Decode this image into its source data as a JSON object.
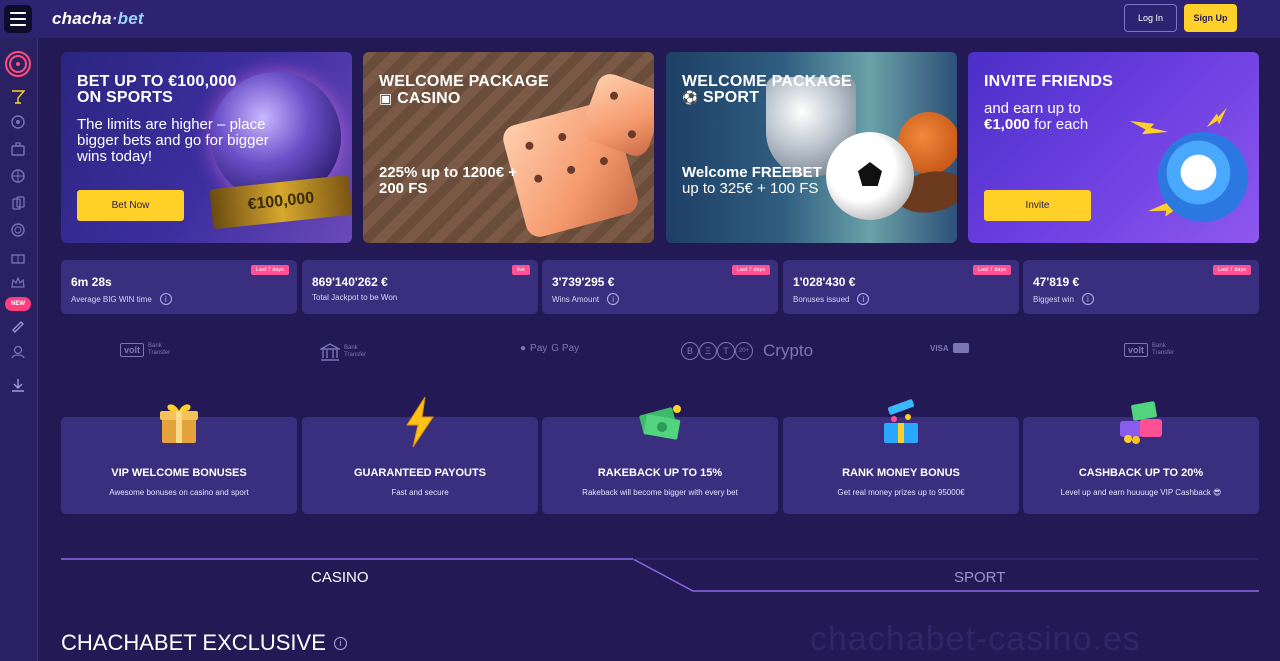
{
  "header": {
    "logo_main": "chacha",
    "logo_dot": "·",
    "logo_sub": "bet",
    "login_label": "Log In",
    "signup_label": "Sign Up"
  },
  "sidebar": {
    "new_badge": "NEW"
  },
  "banners": [
    {
      "title": "BET UP TO €100,000 ON SPORTS",
      "subtitle": "The limits are higher – place bigger bets and go for bigger wins today!",
      "button": "Bet Now"
    },
    {
      "title": "WELCOME PACKAGE",
      "title2": "CASINO",
      "subtitle": "225% up to 1200€ + 200 FS"
    },
    {
      "title": "WELCOME PACKAGE",
      "title2": "SPORT",
      "subtitle_bold": "Welcome FREEBET",
      "subtitle": "up to 325€ + 100 FS"
    },
    {
      "title": "INVITE FRIENDS",
      "subtitle": "and earn up to",
      "subtitle_bold": "€1,000",
      "subtitle_tail": "for each",
      "button": "Invite"
    }
  ],
  "banner_image_text": "€100,000",
  "stats": [
    {
      "value": "6m 28s",
      "label": "Average BIG WIN time",
      "badge": "Last 7 days"
    },
    {
      "value": "869'140'262 €",
      "label": "Total Jackpot to be Won",
      "badge": "live"
    },
    {
      "value": "3'739'295 €",
      "label": "Wins Amount",
      "badge": "Last 7 days"
    },
    {
      "value": "1'028'430 €",
      "label": "Bonuses issued",
      "badge": "Last 7 days"
    },
    {
      "value": "47'819 €",
      "label": "Biggest win",
      "badge": "Last 7 days"
    }
  ],
  "payments": {
    "volt": "volt",
    "bank_line1": "Bank",
    "bank_line2": "Transfer",
    "apple_pay": "Pay",
    "google_pay": "G Pay",
    "crypto": "Crypto",
    "coin_btc": "B",
    "coin_usdt": "T",
    "coin_eth": "Ξ",
    "coin_more": "20+",
    "visa": "VISA"
  },
  "features": [
    {
      "title": "VIP WELCOME BONUSES",
      "desc": "Awesome bonuses on casino and sport"
    },
    {
      "title": "GUARANTEED PAYOUTS",
      "desc": "Fast and secure"
    },
    {
      "title": "RAKEBACK UP TO 15%",
      "desc": "Rakeback will become bigger with every bet"
    },
    {
      "title": "RANK MONEY BONUS",
      "desc": "Get real money prizes up to 95000€"
    },
    {
      "title": "CASHBACK UP TO 20%",
      "desc": "Level up and earn huuuuge VIP Cashback 😎"
    }
  ],
  "tabs": {
    "casino": "CASINO",
    "sport": "SPORT"
  },
  "section": {
    "title": "CHACHABET EXCLUSIVE",
    "info": "i"
  },
  "watermark": "chachabet-casino.es",
  "colors": {
    "accent_yellow": "#ffd028",
    "background": "#231a55",
    "card": "#3a2f7e",
    "badge_pink": "#ff4f95"
  }
}
